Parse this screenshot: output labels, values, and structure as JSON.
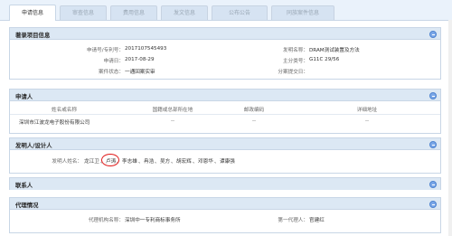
{
  "tabs": [
    {
      "label": "申请信息",
      "active": true
    },
    {
      "label": "审查信息",
      "active": false
    },
    {
      "label": "费用信息",
      "active": false
    },
    {
      "label": "发文信息",
      "active": false
    },
    {
      "label": "公布公告",
      "active": false
    },
    {
      "label": "同族案件信息",
      "active": false
    }
  ],
  "biblio": {
    "title": "著录项目信息",
    "app_no_label": "申请号/专利号：",
    "app_no": "2017107545493",
    "invention_name_label": "发明名称：",
    "invention_name": "DRAM测试装置及方法",
    "app_date_label": "申请日：",
    "app_date": "2017-08-29",
    "ipc_label": "主分类号：",
    "ipc": "G11C 29/56",
    "status_label": "案件状态：",
    "status": "一通回案实审",
    "divisional_label": "分案提交日："
  },
  "applicant": {
    "title": "申请人",
    "headers": [
      "姓名或名称",
      "国籍或总部所在地",
      "邮政编码",
      "详细地址"
    ],
    "rows": [
      [
        "深圳市江波龙电子股份有限公司",
        "--",
        "--",
        "--"
      ]
    ]
  },
  "inventor": {
    "title": "发明人/设计人",
    "label": "发明人姓名：",
    "names": [
      "龙江卫",
      "卢涛",
      "李志雄",
      "冉浩",
      "吴方",
      "胡宏辉",
      "邓恩华",
      "谭康强"
    ],
    "separator": "、"
  },
  "contact": {
    "title": "联系人"
  },
  "agency": {
    "title": "代理情况",
    "agency_label": "代理机构名称：",
    "agency_name": "深圳中一专利商标事务所",
    "first_agent_label": "第一代理人：",
    "first_agent": "官建红"
  },
  "colors": {
    "tab_bg": "#d6e3f2",
    "header_bg": "#dce8f4",
    "border": "#c8d6e6",
    "annotation": "#e01818",
    "collapse_icon": "#7aa7e8"
  }
}
